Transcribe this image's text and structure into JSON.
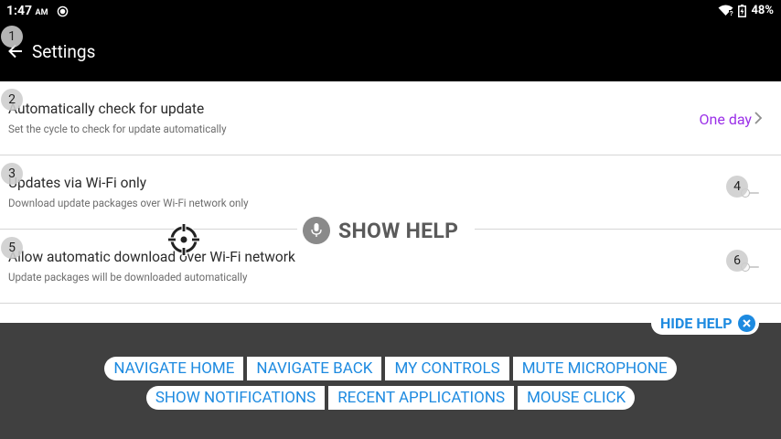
{
  "status_bar": {
    "time": "1:47",
    "ampm": "AM",
    "battery": "48%"
  },
  "app_bar": {
    "title": "Settings"
  },
  "settings": [
    {
      "badge": "2",
      "title": "Automatically check for update",
      "subtitle": "Set the cycle to check for update automatically",
      "value": "One day"
    },
    {
      "badge": "3",
      "title": "Updates via Wi-Fi only",
      "subtitle": "Download update packages over Wi-Fi network only",
      "toggle_badge": "4",
      "toggle_on": false
    },
    {
      "badge": "5",
      "title": "Allow automatic download over Wi-Fi network",
      "subtitle": "Update packages will be downloaded automatically",
      "toggle_badge": "6",
      "toggle_on": false
    }
  ],
  "badges": {
    "back": "1"
  },
  "voice_overlay": {
    "show_help": "SHOW HELP",
    "hide_help": "HIDE HELP",
    "commands_row1": [
      "NAVIGATE HOME",
      "NAVIGATE BACK",
      "MY CONTROLS",
      "MUTE MICROPHONE"
    ],
    "commands_row2": [
      "SHOW NOTIFICATIONS",
      "RECENT APPLICATIONS",
      "MOUSE CLICK"
    ]
  },
  "colors": {
    "accent_purple": "#9b30e8",
    "accent_blue": "#1d8ae0",
    "panel": "#404040"
  }
}
